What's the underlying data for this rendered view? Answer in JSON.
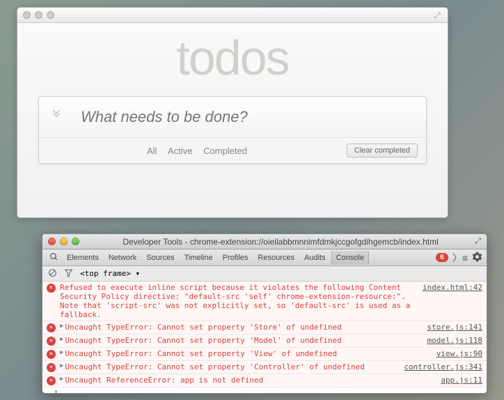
{
  "app": {
    "title": "todos",
    "placeholder": "What needs to be done?",
    "filters": {
      "all": "All",
      "active": "Active",
      "completed": "Completed"
    },
    "clear": "Clear completed"
  },
  "devtools": {
    "title": "Developer Tools - chrome-extension://oieilabbmnnimfdmkjccgofgdihgemcb/index.html",
    "tabs": [
      "Elements",
      "Network",
      "Sources",
      "Timeline",
      "Profiles",
      "Resources",
      "Audits",
      "Console"
    ],
    "activeTab": "Console",
    "errorCount": "6",
    "frameSelector": "<top frame> ▾",
    "errors": [
      {
        "message": "Refused to execute inline script because it violates the following Content Security Policy directive: \"default-src 'self' chrome-extension-resource:\". Note that 'script-src' was not explicitly set, so 'default-src' is used as a fallback.",
        "source": "index.html:42",
        "expandable": false
      },
      {
        "message": "Uncaught TypeError: Cannot set property 'Store' of undefined",
        "source": "store.js:141",
        "expandable": true
      },
      {
        "message": "Uncaught TypeError: Cannot set property 'Model' of undefined",
        "source": "model.js:118",
        "expandable": true
      },
      {
        "message": "Uncaught TypeError: Cannot set property 'View' of undefined",
        "source": "view.js:90",
        "expandable": true
      },
      {
        "message": "Uncaught TypeError: Cannot set property 'Controller' of undefined",
        "source": "controller.js:341",
        "expandable": true
      },
      {
        "message": "Uncaught ReferenceError: app is not defined",
        "source": "app.js:11",
        "expandable": true
      }
    ]
  }
}
